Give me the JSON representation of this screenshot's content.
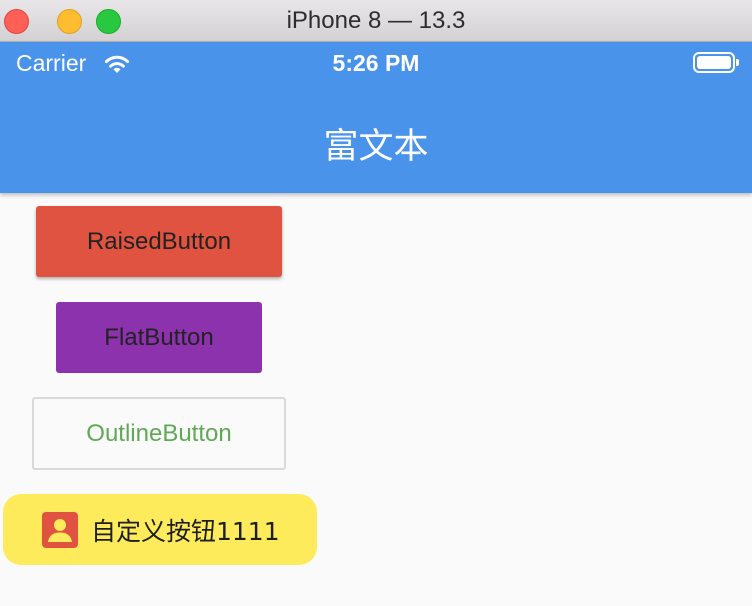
{
  "window": {
    "title": "iPhone 8 — 13.3"
  },
  "status_bar": {
    "carrier": "Carrier",
    "time": "5:26 PM"
  },
  "app_bar": {
    "title": "富文本"
  },
  "buttons": {
    "raised": {
      "label": "RaisedButton",
      "color": "#e05340"
    },
    "flat": {
      "label": "FlatButton",
      "color": "#8d32ad"
    },
    "outline": {
      "label": "OutlineButton",
      "text_color": "#5fa855"
    },
    "custom": {
      "label": "自定义按钮1111",
      "icon": "account-box-icon",
      "color": "#fdeb5b",
      "icon_color": "#e05340"
    }
  },
  "colors": {
    "app_bar": "#4a93eb",
    "background": "#fafafa"
  }
}
